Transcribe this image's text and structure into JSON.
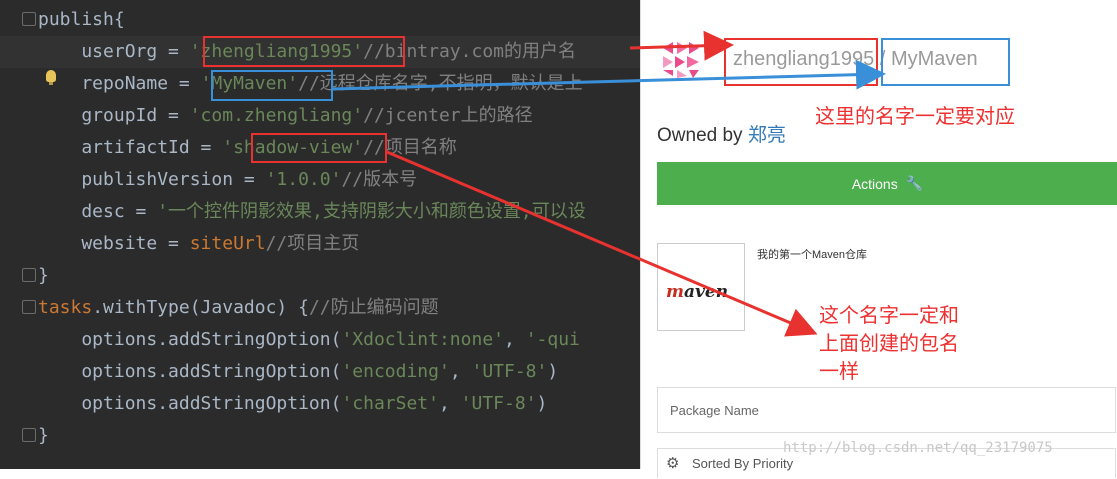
{
  "editor": {
    "lines": [
      {
        "parts": [
          {
            "t": "publish{",
            "c": "fn"
          }
        ]
      },
      {
        "parts": [
          {
            "t": "    userOrg = ",
            "c": "fn"
          },
          {
            "t": "'zhengliang1995'",
            "c": "str"
          },
          {
            "t": "//bintray.com的用户名",
            "c": "cm"
          }
        ]
      },
      {
        "parts": [
          {
            "t": "    repoName = ",
            "c": "fn"
          },
          {
            "t": "'MyMaven'",
            "c": "str"
          },
          {
            "t": "//远程仓库名字,不指明，默认是上",
            "c": "cm"
          }
        ]
      },
      {
        "parts": [
          {
            "t": "    groupId = ",
            "c": "fn"
          },
          {
            "t": "'com.zhengliang'",
            "c": "str"
          },
          {
            "t": "//jcenter上的路径",
            "c": "cm"
          }
        ]
      },
      {
        "parts": [
          {
            "t": "    artifactId = ",
            "c": "fn"
          },
          {
            "t": "'shadow-view'",
            "c": "str"
          },
          {
            "t": "//项目名称",
            "c": "cm"
          }
        ]
      },
      {
        "parts": [
          {
            "t": "    publishVersion = ",
            "c": "fn"
          },
          {
            "t": "'1.0.0'",
            "c": "str"
          },
          {
            "t": "//版本号",
            "c": "cm"
          }
        ]
      },
      {
        "parts": [
          {
            "t": "    desc = ",
            "c": "fn"
          },
          {
            "t": "'一个控件阴影效果,支持阴影大小和颜色设置,可以设",
            "c": "str"
          }
        ]
      },
      {
        "parts": [
          {
            "t": "    website = ",
            "c": "fn"
          },
          {
            "t": "siteUrl",
            "c": "ref"
          },
          {
            "t": "//项目主页",
            "c": "cm"
          }
        ]
      },
      {
        "parts": [
          {
            "t": "}",
            "c": "fn"
          }
        ]
      },
      {
        "parts": [
          {
            "t": "tasks",
            "c": "kw"
          },
          {
            "t": ".withType(Javadoc) {",
            "c": "fn"
          },
          {
            "t": "//防止编码问题",
            "c": "cm"
          }
        ]
      },
      {
        "parts": [
          {
            "t": "    options.addStringOption(",
            "c": "fn"
          },
          {
            "t": "'Xdoclint:none'",
            "c": "str"
          },
          {
            "t": ", ",
            "c": "fn"
          },
          {
            "t": "'-qui",
            "c": "str"
          }
        ]
      },
      {
        "parts": [
          {
            "t": "    options.addStringOption(",
            "c": "fn"
          },
          {
            "t": "'encoding'",
            "c": "str"
          },
          {
            "t": ", ",
            "c": "fn"
          },
          {
            "t": "'UTF-8'",
            "c": "str"
          },
          {
            "t": ")",
            "c": "fn"
          }
        ]
      },
      {
        "parts": [
          {
            "t": "    options.addStringOption(",
            "c": "fn"
          },
          {
            "t": "'charSet'",
            "c": "str"
          },
          {
            "t": ", ",
            "c": "fn"
          },
          {
            "t": "'UTF-8'",
            "c": "str"
          },
          {
            "t": ")",
            "c": "fn"
          }
        ]
      },
      {
        "parts": [
          {
            "t": "}",
            "c": "fn"
          }
        ]
      }
    ]
  },
  "bintray": {
    "user": "zhengliang1995",
    "separator": "/",
    "repo": "MyMaven",
    "owned_by_label": "Owned by",
    "owner": "郑亮",
    "actions_label": "Actions",
    "actions_icon": "wrench-icon",
    "repo_description": "我的第一个Maven仓库",
    "maven_logo_m": "m",
    "maven_logo_rest": "aven",
    "package_name_placeholder": "Package Name",
    "sort_label": "Sorted By Priority",
    "sort_icon": "gear-icon"
  },
  "annotations": {
    "note_top": "这里的名字一定要对应",
    "note_bottom_lines": [
      "这个名字一定和",
      "上面创建的包名",
      "一样"
    ]
  },
  "watermark": "http://blog.csdn.net/qq_23179075",
  "colors": {
    "editor_bg": "#2b2b2b",
    "string": "#6a8759",
    "comment": "#808080",
    "keyword": "#cc7832",
    "annotation_red": "#e8322f",
    "annotation_blue": "#3a8fd9",
    "actions_green": "#4cae4c"
  }
}
